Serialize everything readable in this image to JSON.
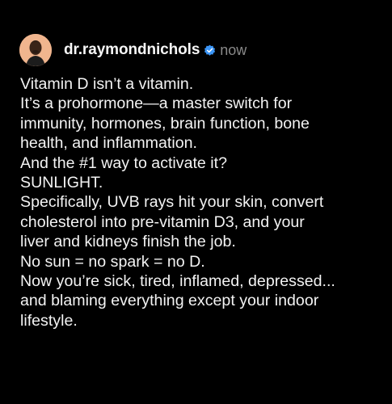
{
  "post": {
    "username": "dr.raymondnichols",
    "timestamp": "now",
    "lines": [
      "Vitamin D isn’t a vitamin.",
      "It’s a prohormone—a master switch for",
      "immunity, hormones, brain function, bone",
      "health, and inflammation.",
      "And the #1 way to activate it?",
      "SUNLIGHT.",
      "Specifically, UVB rays hit your skin, convert",
      "cholesterol into pre-vitamin D3, and your",
      "liver and kidneys finish the job.",
      "No sun = no spark = no D.",
      "Now you’re sick, tired, inflamed, depressed...",
      "and blaming everything except your indoor",
      "lifestyle."
    ]
  },
  "icons": {
    "avatar": "profile-photo",
    "verified": "verified-badge-icon"
  },
  "colors": {
    "background": "#000000",
    "text": "#f3f3f3",
    "timestamp": "#8a8a8a",
    "verified": "#3b95f6"
  }
}
